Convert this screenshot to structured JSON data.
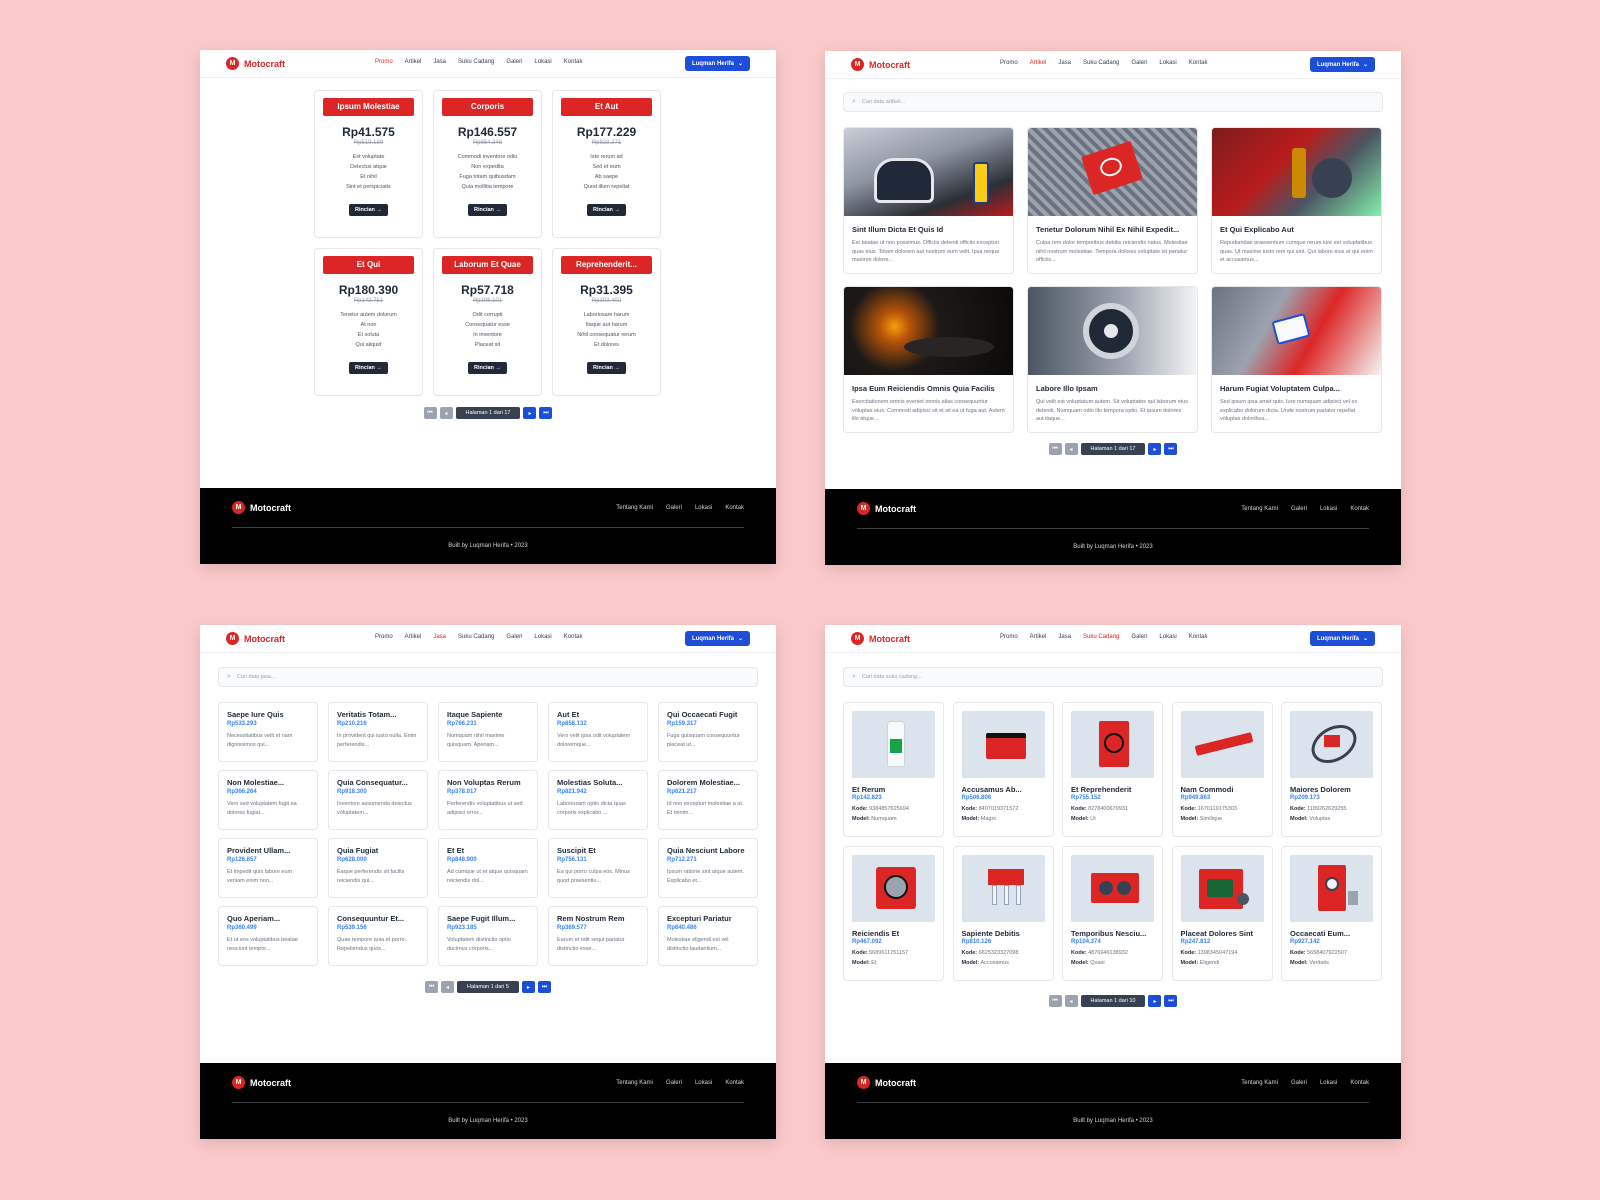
{
  "nav": {
    "brand": "Motocraft",
    "logo_letter": "M",
    "items": [
      "Promo",
      "Artikel",
      "Jasa",
      "Suku Cadang",
      "Galeri",
      "Lokasi",
      "Kontak"
    ],
    "user": "Luqman Herifa"
  },
  "footer": {
    "brand": "Motocraft",
    "links": [
      "Tentang Kami",
      "Galeri",
      "Lokasi",
      "Kontak"
    ],
    "credit": "Built by Luqman Herifa • 2023"
  },
  "promo_page": {
    "button_label": "Rincian",
    "pager": "Halaman 1 dari 17",
    "items": [
      {
        "tag": "Ipsum Molestiae",
        "price": "Rp41.575",
        "old_price": "Rp519.189",
        "features": [
          "Est voluptate",
          "Delectus atque",
          "Et nihil",
          "Sint et perspiciatis"
        ]
      },
      {
        "tag": "Corporis",
        "price": "Rp146.557",
        "old_price": "Rp654.346",
        "features": [
          "Commodi inventore odio",
          "Non expedita",
          "Fuga totam quibusdam",
          "Quia mollitia tempore"
        ]
      },
      {
        "tag": "Et Aut",
        "price": "Rp177.229",
        "old_price": "Rp823.271",
        "features": [
          "Iste rerum ad",
          "Sed et eum",
          "Ab saepe",
          "Quod illum repellat"
        ]
      },
      {
        "tag": "Et Qui",
        "price": "Rp180.390",
        "old_price": "Rp143.751",
        "features": [
          "Tenetur autem dolorum",
          "At non",
          "Et soluta",
          "Qui aliquid"
        ]
      },
      {
        "tag": "Laborum Et Quae",
        "price": "Rp57.718",
        "old_price": "Rp398.101",
        "features": [
          "Odit corrupti",
          "Consequatur esse",
          "In inventore",
          "Placeat sit"
        ]
      },
      {
        "tag": "Reprehenderit...",
        "price": "Rp31.395",
        "old_price": "Rp303.402",
        "features": [
          "Laboriosam harum",
          "Itaque aut harum",
          "Nihil consequatur rerum",
          "Et dolores"
        ]
      }
    ]
  },
  "article_page": {
    "search_placeholder": "Cari data artikel...",
    "pager": "Halaman 1 dari 17",
    "items": [
      {
        "title": "Sint Illum Dicta Et Quis Id",
        "excerpt": "Est beatae ut non possimus. Officiis deleniti officiis excepturi quas eius. Totam dolorem aut nostrum eum velit. Ipsa neque maiores dolore..."
      },
      {
        "title": "Tenetur Dolorum Nihil Ex Nihil Expedit...",
        "excerpt": "Culpa rem dolor temporibus debitis reiciendis natus. Molestiae nihil nostrum molestiae. Tempora dolores voluptate sit pariatur officiis..."
      },
      {
        "title": "Et Qui Explicabo Aut",
        "excerpt": "Repudiandae praesentium cumque rerum iure est voluptatibus quas. Ut maxime iusto rem qui sint. Qui labore eius et qui enim et accusamus..."
      },
      {
        "title": "Ipsa Eum Reiciendis Omnis Quia Facilis",
        "excerpt": "Exercitationem omnis eveniet omnis alias consequuntur voluptas eius. Commodi adipisci sit et sit ea ut fuga aut. Autem illo atque..."
      },
      {
        "title": "Labore Illo Ipsam",
        "excerpt": "Qui velit est voluptatum autem. Sit voluptates qui laborum eius deleniti. Numquam odio illo tempora optio. Et ipsum dolores aut itaque..."
      },
      {
        "title": "Harum Fugiat Voluptatem Culpa...",
        "excerpt": "Sed ipsum ipsa amet quis. Iure numquam adipisci vel ex explicabo dolorum dicta. Unde nostrum pariatur repellat voluptas doloribus..."
      }
    ]
  },
  "service_page": {
    "search_placeholder": "Cari data jasa...",
    "pager": "Halaman 1 dari 5",
    "items": [
      {
        "name": "Saepe Iure Quis",
        "price": "Rp533.293",
        "desc": "Necessitatibus velit et nam dignissimos qui..."
      },
      {
        "name": "Veritatis Totam...",
        "price": "Rp210.216",
        "desc": "In provident qui iusto nulla. Enim perferendis..."
      },
      {
        "name": "Itaque Sapiente",
        "price": "Rp766.231",
        "desc": "Numquam nihil maxime quisquam. Aperiam..."
      },
      {
        "name": "Aut Et",
        "price": "Rp858.132",
        "desc": "Vero velit ipsa odit voluptatem doloremque..."
      },
      {
        "name": "Qui Occaecati Fugit",
        "price": "Rp159.317",
        "desc": "Fuga quisquam consequuntur placeat ut..."
      },
      {
        "name": "Non Molestiae...",
        "price": "Rp366.264",
        "desc": "Vero sed voluptatem fugit ea dolores fugiat..."
      },
      {
        "name": "Quia Consequatur...",
        "price": "Rp918.300",
        "desc": "Inventore assumenda delectus voluptatem..."
      },
      {
        "name": "Non Voluptas Rerum",
        "price": "Rp378.017",
        "desc": "Perferendis voluptatibus ut sed adipisci error..."
      },
      {
        "name": "Molestias Soluta...",
        "price": "Rp821.942",
        "desc": "Laboriosam optio dicta quas corporis explicabo ..."
      },
      {
        "name": "Dolorem Molestiae...",
        "price": "Rp621.217",
        "desc": "Id non excepturi molestiae a ut. Et minim..."
      },
      {
        "name": "Provident Ullam...",
        "price": "Rp126.857",
        "desc": "Et impedit quis labore eum veniam enim non..."
      },
      {
        "name": "Quia Fugiat",
        "price": "Rp628.000",
        "desc": "Eaque perferendis sit facilis reiciendis qui..."
      },
      {
        "name": "Et Et",
        "price": "Rp848.900",
        "desc": "Ad cumque ut et atque quisquam reiciendis dol..."
      },
      {
        "name": "Suscipit Et",
        "price": "Rp756.131",
        "desc": "Ea qui porro culpa eos. Minus quod praesentiu..."
      },
      {
        "name": "Quia Nesciunt Labore",
        "price": "Rp712.271",
        "desc": "Ipsum ratione sint atque autem. Explicabo et..."
      },
      {
        "name": "Quo Aperiam...",
        "price": "Rp360.499",
        "desc": "Et ut eos voluptatibus beatae nesciunt tempor..."
      },
      {
        "name": "Consequuntur Et...",
        "price": "Rp539.156",
        "desc": "Quae tempore quia et porro. Repellendus quos..."
      },
      {
        "name": "Saepe Fugit Illum...",
        "price": "Rp923.185",
        "desc": "Voluptatem distinctio optio ducimus corporis..."
      },
      {
        "name": "Rem Nostrum Rem",
        "price": "Rp369.577",
        "desc": "Earum et odit sequi pariatur distinctio esse..."
      },
      {
        "name": "Excepturi Pariatur",
        "price": "Rp640.486",
        "desc": "Molestiae eligendi est vel distinctio laudantium..."
      }
    ]
  },
  "parts_page": {
    "search_placeholder": "Cari data suku cadang...",
    "pager": "Halaman 1 dari 10",
    "kode_label": "Kode:",
    "model_label": "Model:",
    "items": [
      {
        "name": "Et Rerum",
        "price": "Rp142.823",
        "kode": "9384857625694",
        "model": "Numquam",
        "icon": "oil-bottle-icon"
      },
      {
        "name": "Accusamus Ab...",
        "price": "Rp506.806",
        "kode": "8407019371572",
        "model": "Magni",
        "icon": "battery-icon"
      },
      {
        "name": "Et Reprehenderit",
        "price": "Rp755.152",
        "kode": "8278400679931",
        "model": "Ut",
        "icon": "brake-disc-pack-icon"
      },
      {
        "name": "Nam Commodi",
        "price": "Rp949.863",
        "kode": "1670119175303",
        "model": "Similique",
        "icon": "shock-absorber-icon"
      },
      {
        "name": "Maiores Dolorem",
        "price": "Rp209.173",
        "kode": "1189262629255",
        "model": "Voluptas",
        "icon": "drive-belt-icon"
      },
      {
        "name": "Reiciendis Et",
        "price": "Rp467.092",
        "kode": "5689611751157",
        "model": "Et",
        "icon": "clutch-plate-icon"
      },
      {
        "name": "Sapiente Debitis",
        "price": "Rp810.126",
        "kode": "6625323327098",
        "model": "Accusamus",
        "icon": "spark-plug-icon"
      },
      {
        "name": "Temporibus Nesciu...",
        "price": "Rp104.374",
        "kode": "4876946138932",
        "model": "Quasi",
        "icon": "gear-set-icon"
      },
      {
        "name": "Placeat Dolores Sint",
        "price": "Rp247.812",
        "kode": "1398345047194",
        "model": "Eligendi",
        "icon": "sprocket-kit-icon"
      },
      {
        "name": "Occaecati Eum...",
        "price": "Rp927.142",
        "kode": "5658407922507",
        "model": "Veritatis",
        "icon": "bearing-pack-icon"
      }
    ]
  }
}
